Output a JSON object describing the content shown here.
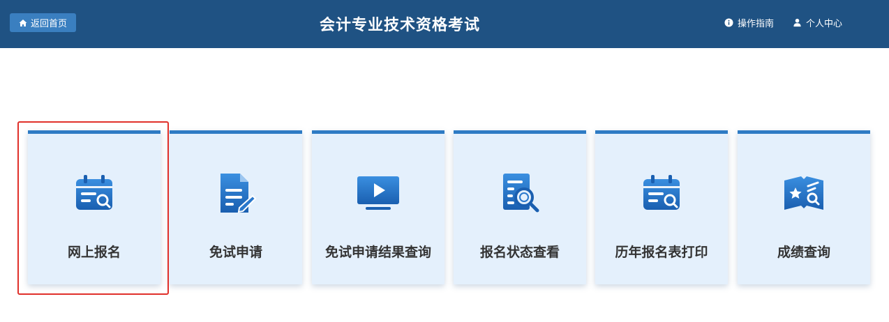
{
  "header": {
    "home_label": "返回首页",
    "title": "会计专业技术资格考试",
    "guide_label": "操作指南",
    "personal_label": "个人中心"
  },
  "cards": [
    {
      "label": "网上报名",
      "icon": "calendar-search-icon",
      "selected": true
    },
    {
      "label": "免试申请",
      "icon": "document-edit-icon"
    },
    {
      "label": "免试申请结果查询",
      "icon": "monitor-play-icon"
    },
    {
      "label": "报名状态查看",
      "icon": "document-search-icon"
    },
    {
      "label": "历年报名表打印",
      "icon": "calendar-search-icon"
    },
    {
      "label": "成绩查询",
      "icon": "book-star-search-icon"
    }
  ],
  "colors": {
    "header_bg": "#1f5283",
    "accent": "#2e7bc4",
    "card_bg": "#e4f0fc",
    "highlight": "#e0302a"
  }
}
